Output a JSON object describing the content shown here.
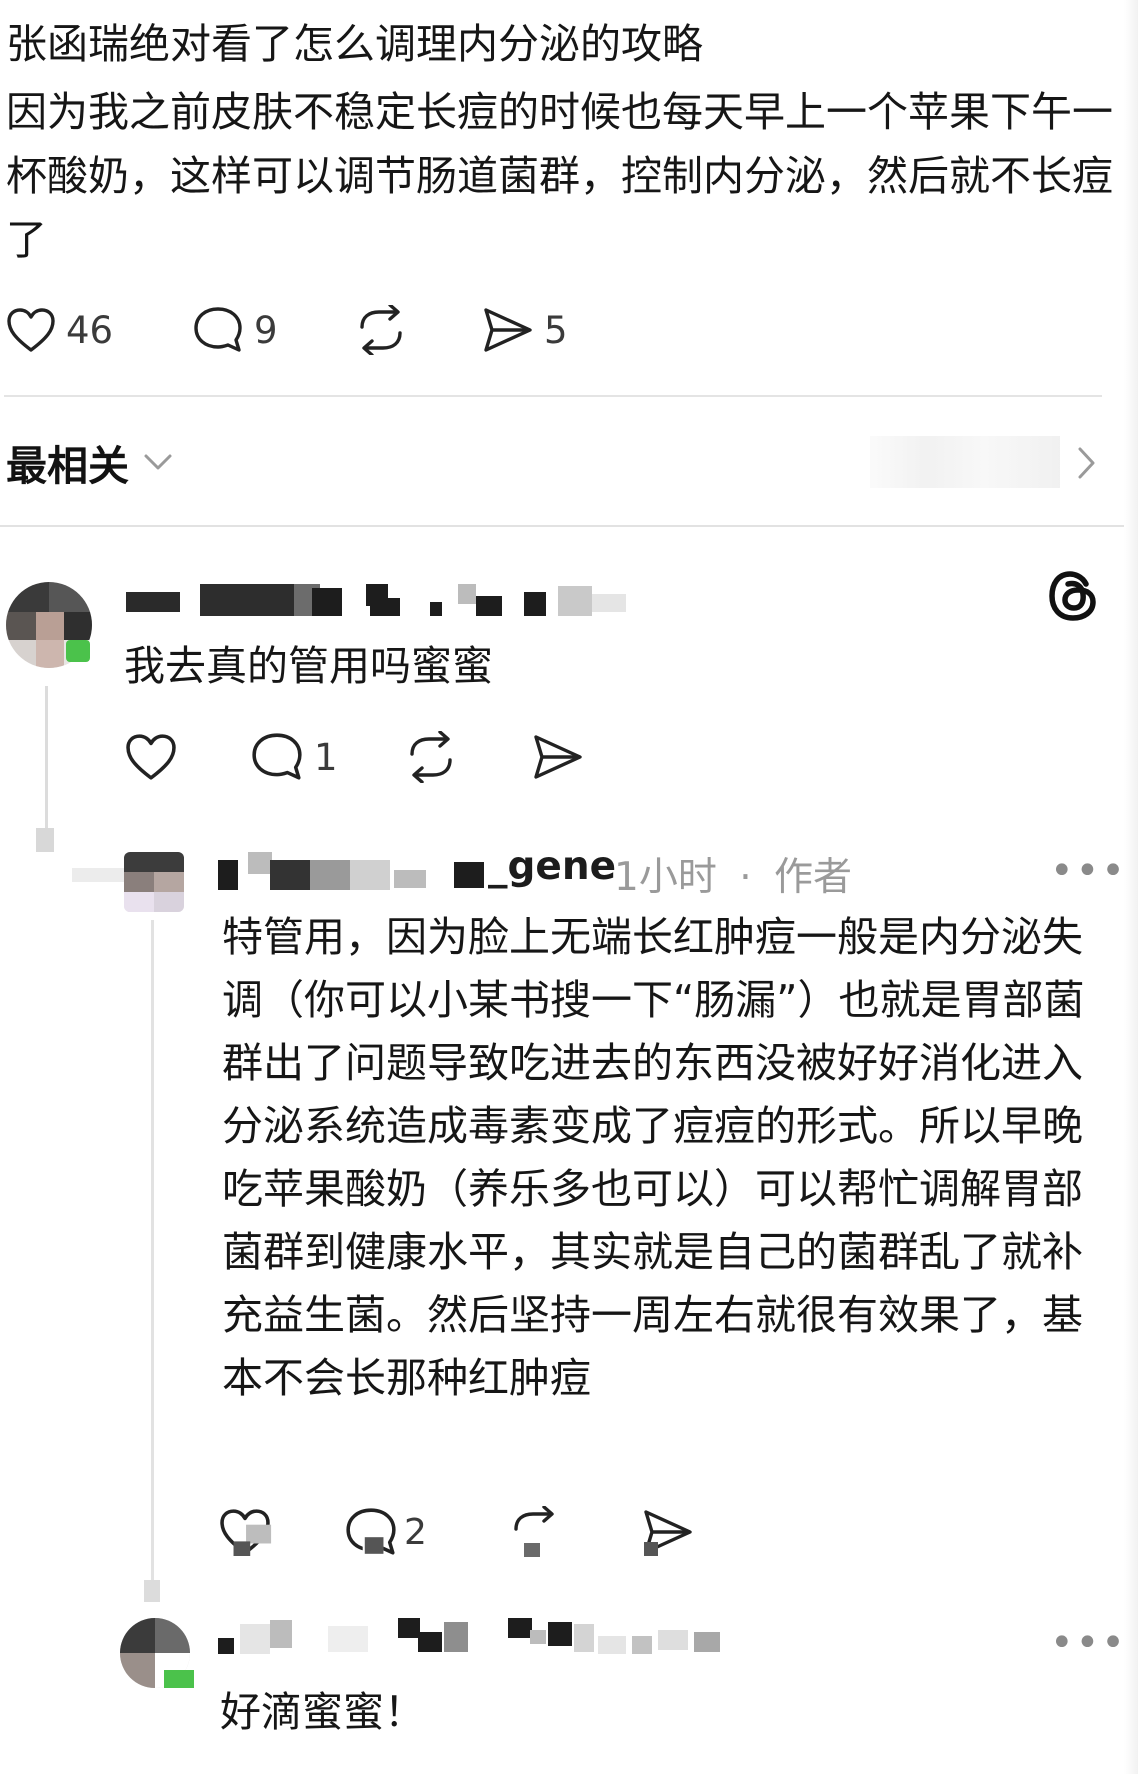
{
  "post": {
    "title": "张函瑞绝对看了怎么调理内分泌的攻略",
    "body": "因为我之前皮肤不稳定长痘的时候也每天早上一个苹果下午一杯酸奶，这样可以调节肠道菌群，控制内分泌，然后就不长痘了",
    "likes": "46",
    "comments": "9",
    "shares": "5"
  },
  "sort": {
    "label": "最相关"
  },
  "comment1": {
    "text": "我去真的管用吗蜜蜜",
    "reply_count": "1"
  },
  "reply1": {
    "username_visible": "_gene",
    "time": "1小时",
    "separator": "·",
    "author_badge": "作者",
    "text": "特管用，因为脸上无端长红肿痘一般是内分泌失调（你可以小某书搜一下“肠漏”）也就是胃部菌群出了问题导致吃进去的东西没被好好消化进入分泌系统造成毒素变成了痘痘的形式。所以早晚吃苹果酸奶（养乐多也可以）可以帮忙调解胃部菌群到健康水平，其实就是自己的菌群乱了就补充益生菌。然后坚持一周左右就很有效果了，基本不会长那种红肿痘",
    "reply_count": "2"
  },
  "reply2": {
    "text": "好滴蜜蜜！"
  },
  "more_label": "•••",
  "icons": {
    "like": "heart-icon",
    "comment": "comment-bubble-icon",
    "repost": "repost-icon",
    "share": "send-icon",
    "chevron": "chevron-down-icon",
    "arrow": "chevron-right-icon",
    "brand": "threads-logo-icon"
  }
}
